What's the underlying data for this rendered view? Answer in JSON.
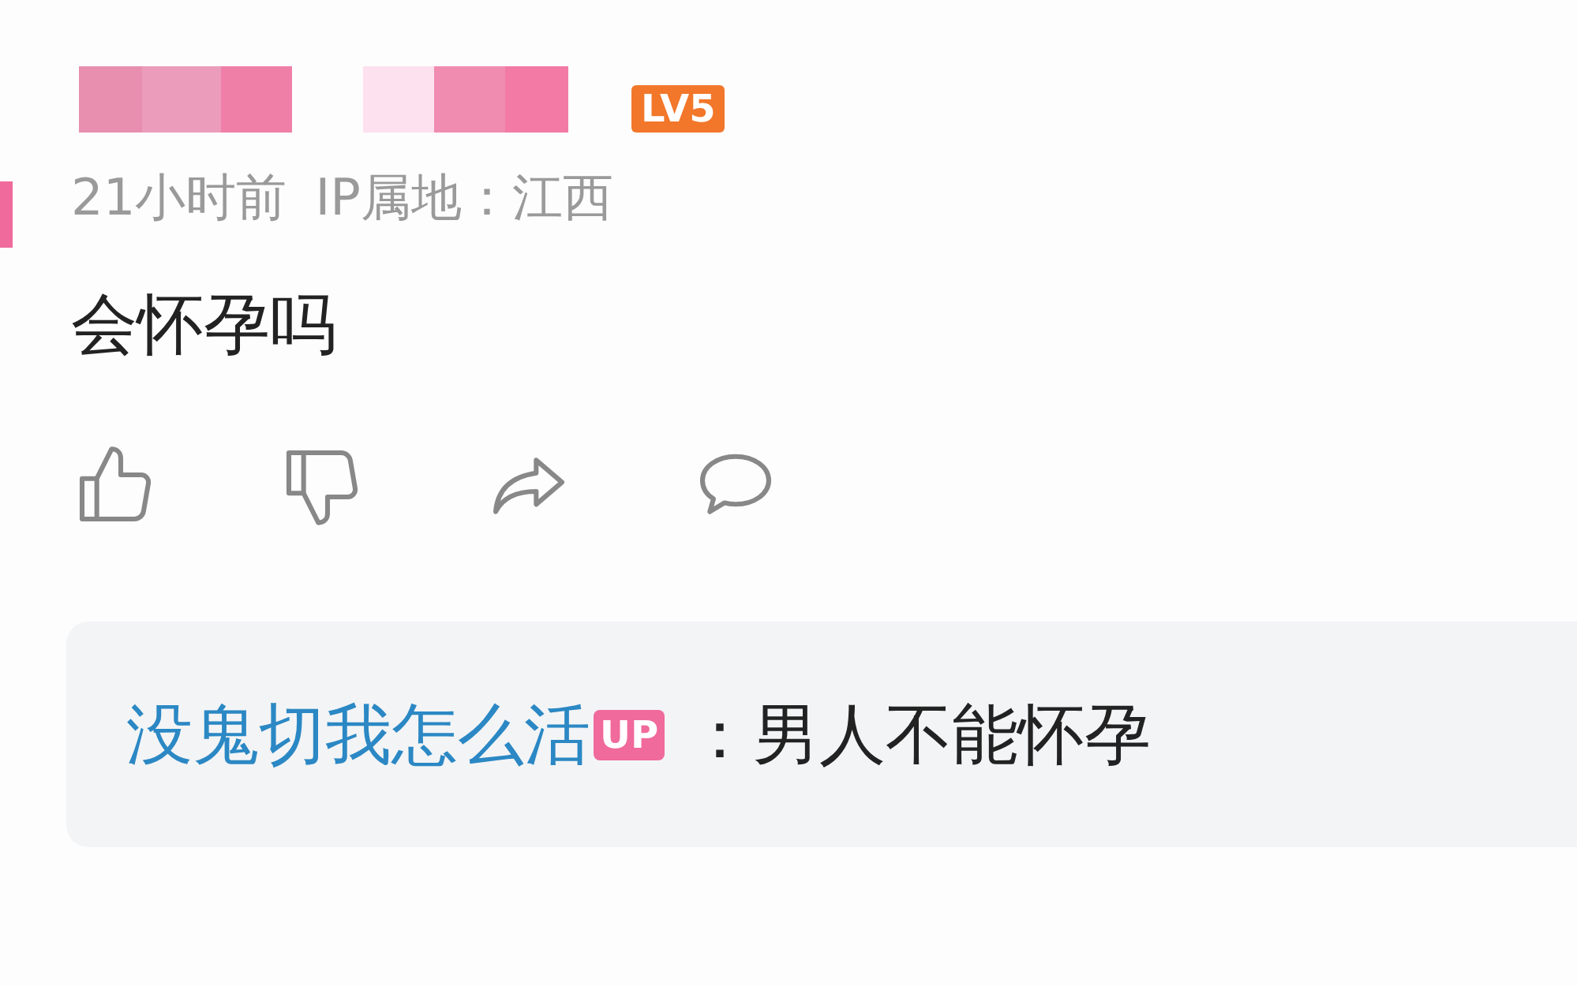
{
  "comment": {
    "level_badge": "LV5",
    "time": "21小时前",
    "ip_location": "IP属地：江西",
    "text": "会怀孕吗"
  },
  "reply": {
    "author": "没鬼切我怎么活",
    "author_badge": "UP",
    "text": "：男人不能怀孕"
  }
}
